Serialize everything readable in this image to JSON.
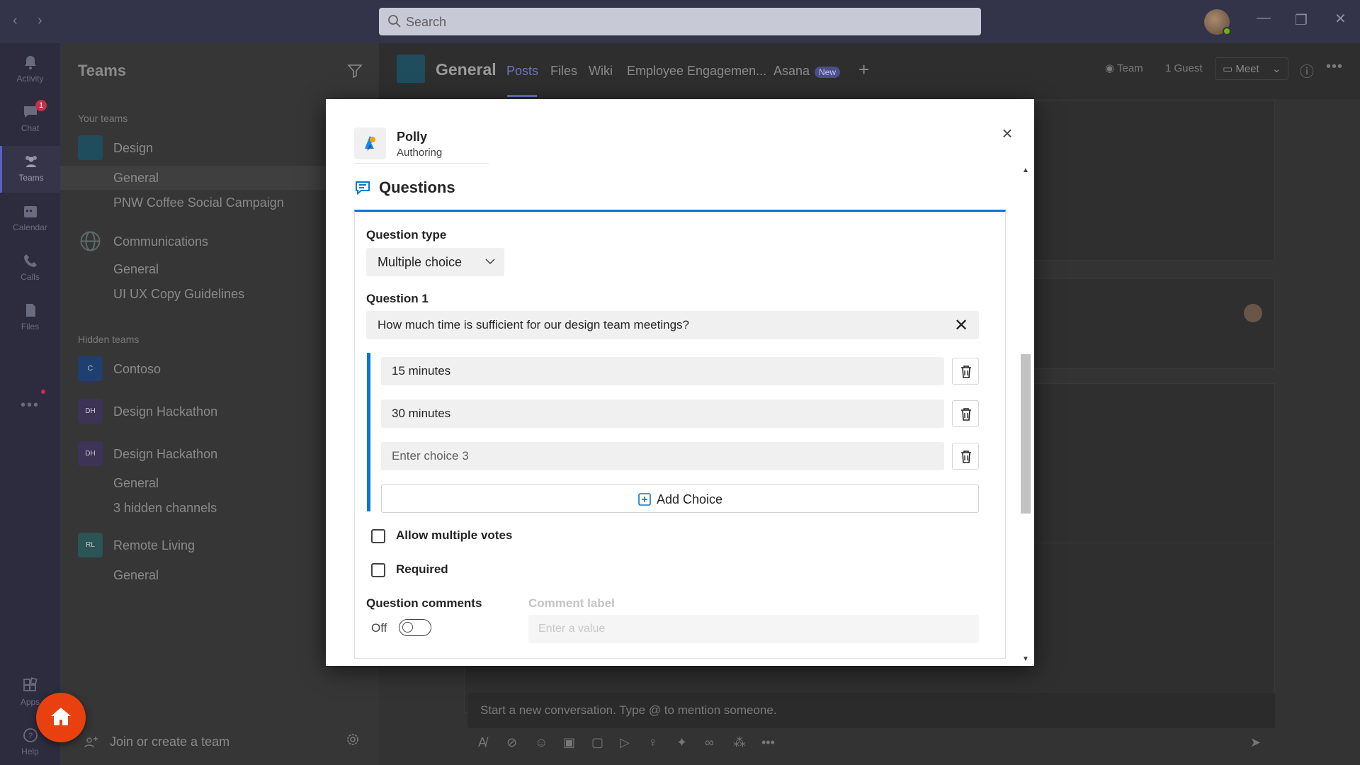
{
  "topbar": {
    "search_placeholder": "Search"
  },
  "rail": {
    "items": [
      {
        "label": "Activity",
        "icon": "bell-icon"
      },
      {
        "label": "Chat",
        "icon": "chat-icon",
        "badge": "1"
      },
      {
        "label": "Teams",
        "icon": "teams-icon"
      },
      {
        "label": "Calendar",
        "icon": "calendar-icon"
      },
      {
        "label": "Calls",
        "icon": "phone-icon"
      },
      {
        "label": "Files",
        "icon": "file-icon"
      }
    ],
    "more": "•••",
    "apps_label": "Apps",
    "help_label": "Help"
  },
  "teamlist": {
    "title": "Teams",
    "your_teams_label": "Your teams",
    "hidden_teams_label": "Hidden teams",
    "teams": [
      {
        "name": "Design",
        "initials": "",
        "color": "#1f4d5e",
        "channels": [
          "General",
          "PNW Coffee Social Campaign"
        ]
      },
      {
        "name": "Communications",
        "initials": "",
        "color": "#2f4a4a",
        "channels": [
          "General",
          "UI UX Copy Guidelines"
        ]
      }
    ],
    "hidden_teams": [
      {
        "name": "Contoso",
        "initials": "C",
        "color": "#1f3f6e"
      },
      {
        "name": "Design Hackathon",
        "initials": "DH",
        "color": "#3d3357"
      },
      {
        "name": "Design Hackathon",
        "initials": "DH",
        "color": "#3d3357",
        "channels": [
          "General",
          "3 hidden channels"
        ]
      },
      {
        "name": "Remote Living",
        "initials": "RL",
        "color": "#2b5454",
        "channels": [
          "General"
        ]
      }
    ],
    "footer_join": "Join or create a team"
  },
  "channel_header": {
    "title": "General",
    "tabs": [
      "Posts",
      "Files",
      "Wiki",
      "Employee Engagemen...",
      "Asana"
    ],
    "new_badge": "New",
    "team_label": "Team",
    "guest_label": "1 Guest",
    "meet_label": "Meet"
  },
  "composer": {
    "placeholder": "Start a new conversation. Type @ to mention someone."
  },
  "modal": {
    "app_name": "Polly",
    "app_subtitle": "Authoring",
    "section_title": "Questions",
    "question_type_label": "Question type",
    "question_type_value": "Multiple choice",
    "question_label": "Question 1",
    "question_value": "How much time is sufficient for our design team meetings?",
    "choices": [
      {
        "value": "15 minutes",
        "placeholder": false
      },
      {
        "value": "30 minutes",
        "placeholder": false
      },
      {
        "value": "Enter choice 3",
        "placeholder": true
      }
    ],
    "add_choice_label": "Add Choice",
    "allow_multiple_votes_label": "Allow multiple votes",
    "required_label": "Required",
    "question_comments_label": "Question comments",
    "toggle_state_label": "Off",
    "comment_label_title": "Comment label",
    "comment_label_placeholder": "Enter a value"
  },
  "colors": {
    "accent_blue": "#0078d4",
    "teams_purple": "#6d73c9",
    "home_fab": "#e8400f"
  }
}
